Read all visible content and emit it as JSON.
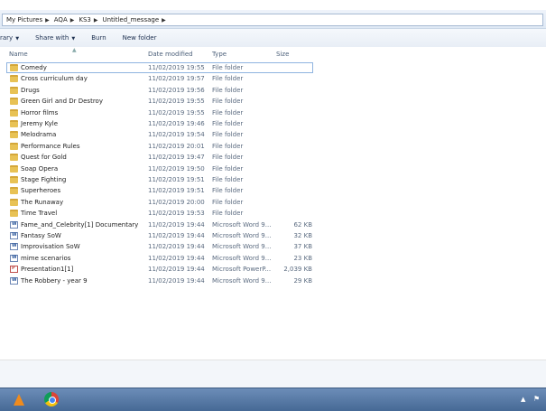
{
  "breadcrumb": [
    "My Pictures",
    "AQA",
    "KS3",
    "Untitled_message"
  ],
  "toolbar": {
    "library_label": "rary",
    "share_label": "Share with",
    "burn_label": "Burn",
    "new_folder_label": "New folder"
  },
  "columns": {
    "name": "Name",
    "date": "Date modified",
    "type": "Type",
    "size": "Size"
  },
  "files": [
    {
      "name": "Comedy",
      "date": "11/02/2019 19:55",
      "type": "File folder",
      "size": "",
      "icon": "folder-icon"
    },
    {
      "name": "Cross curriculum day",
      "date": "11/02/2019 19:57",
      "type": "File folder",
      "size": "",
      "icon": "folder-icon"
    },
    {
      "name": "Drugs",
      "date": "11/02/2019 19:56",
      "type": "File folder",
      "size": "",
      "icon": "folder-icon"
    },
    {
      "name": "Green Girl and Dr Destroy",
      "date": "11/02/2019 19:55",
      "type": "File folder",
      "size": "",
      "icon": "folder-icon"
    },
    {
      "name": "Horror films",
      "date": "11/02/2019 19:55",
      "type": "File folder",
      "size": "",
      "icon": "folder-icon"
    },
    {
      "name": "Jeremy Kyle",
      "date": "11/02/2019 19:46",
      "type": "File folder",
      "size": "",
      "icon": "folder-icon"
    },
    {
      "name": "Melodrama",
      "date": "11/02/2019 19:54",
      "type": "File folder",
      "size": "",
      "icon": "folder-icon"
    },
    {
      "name": "Performance Rules",
      "date": "11/02/2019 20:01",
      "type": "File folder",
      "size": "",
      "icon": "folder-icon"
    },
    {
      "name": "Quest for Gold",
      "date": "11/02/2019 19:47",
      "type": "File folder",
      "size": "",
      "icon": "folder-icon"
    },
    {
      "name": "Soap Opera",
      "date": "11/02/2019 19:50",
      "type": "File folder",
      "size": "",
      "icon": "folder-icon"
    },
    {
      "name": "Stage Fighting",
      "date": "11/02/2019 19:51",
      "type": "File folder",
      "size": "",
      "icon": "folder-icon"
    },
    {
      "name": "Superheroes",
      "date": "11/02/2019 19:51",
      "type": "File folder",
      "size": "",
      "icon": "folder-icon"
    },
    {
      "name": "The Runaway",
      "date": "11/02/2019 20:00",
      "type": "File folder",
      "size": "",
      "icon": "folder-icon"
    },
    {
      "name": "Time Travel",
      "date": "11/02/2019 19:53",
      "type": "File folder",
      "size": "",
      "icon": "folder-icon"
    },
    {
      "name": "Fame_and_Celebrity[1] Documentary",
      "date": "11/02/2019 19:44",
      "type": "Microsoft Word 9...",
      "size": "62 KB",
      "icon": "word-document-icon"
    },
    {
      "name": "Fantasy SoW",
      "date": "11/02/2019 19:44",
      "type": "Microsoft Word 9...",
      "size": "32 KB",
      "icon": "word-document-icon"
    },
    {
      "name": "Improvisation SoW",
      "date": "11/02/2019 19:44",
      "type": "Microsoft Word 9...",
      "size": "37 KB",
      "icon": "word-document-icon"
    },
    {
      "name": "mime scenarios",
      "date": "11/02/2019 19:44",
      "type": "Microsoft Word 9...",
      "size": "23 KB",
      "icon": "word-document-icon"
    },
    {
      "name": "Presentation1[1]",
      "date": "11/02/2019 19:44",
      "type": "Microsoft PowerP...",
      "size": "2,039 KB",
      "icon": "powerpoint-document-icon"
    },
    {
      "name": "The Robbery - year 9",
      "date": "11/02/2019 19:44",
      "type": "Microsoft Word 9...",
      "size": "29 KB",
      "icon": "word-document-icon"
    }
  ],
  "taskbar": {
    "apps": [
      "vlc-icon",
      "chrome-icon"
    ]
  }
}
